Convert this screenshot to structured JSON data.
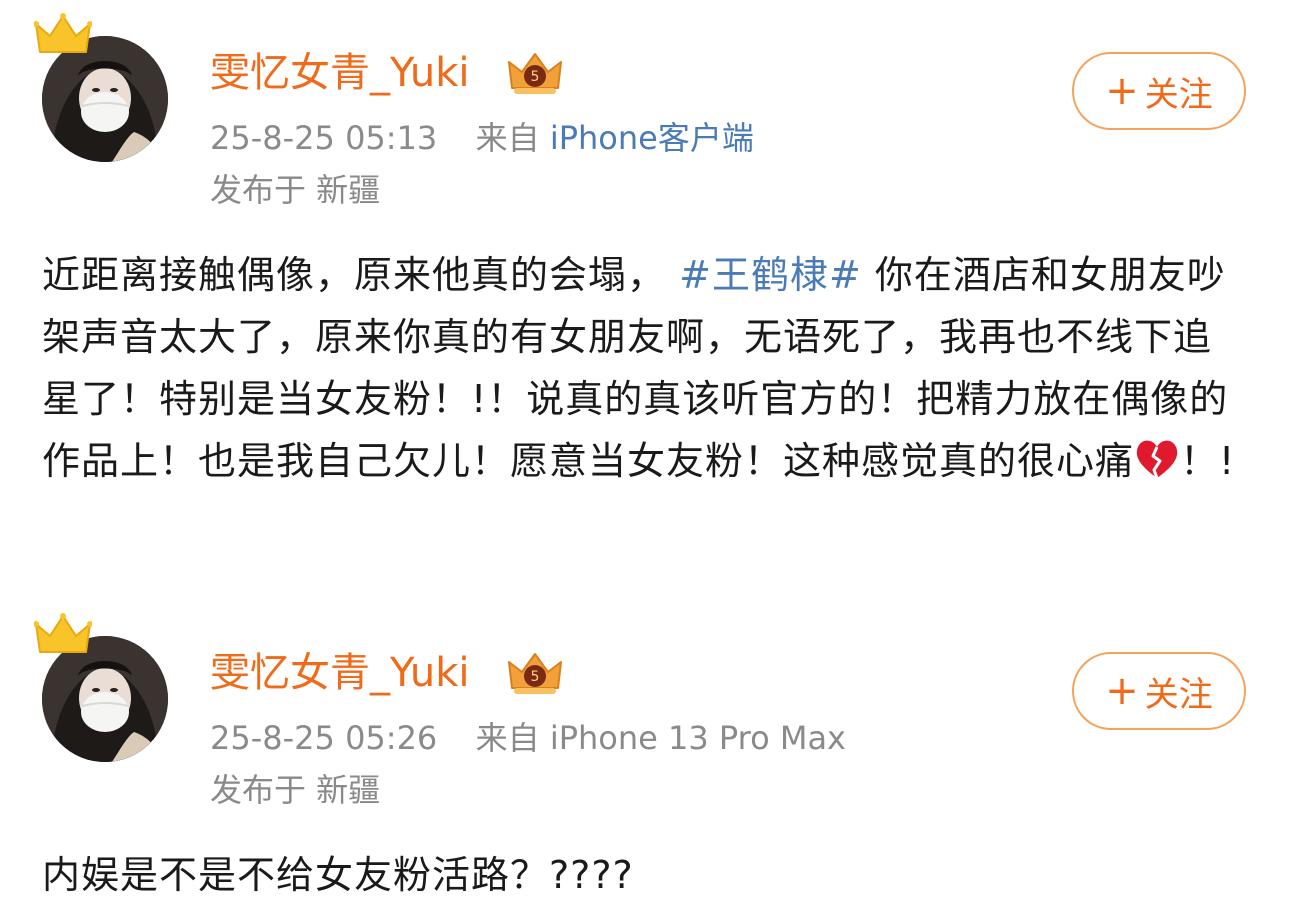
{
  "posts": [
    {
      "username": "雯忆女青_Yuki",
      "timestamp": "25-8-25 05:13",
      "source_prefix": "来自",
      "source_app": "iPhone客户端",
      "location": "发布于 新疆",
      "follow_label": "关注",
      "follow_plus": "+",
      "text_before_tag": "近距离接触偶像，原来他真的会塌，",
      "hashtag": "#王鹤棣#",
      "text_after_tag": " 你在酒店和女朋友吵架声音太大了，原来你真的有女朋友啊，无语死了，我再也不线下追星了！特别是当女友粉！!！说真的真该听官方的！把精力放在偶像的作品上！也是我自己欠儿！愿意当女友粉！这种感觉真的很心痛",
      "text_tail": "！!",
      "emoji": "broken-heart-icon"
    },
    {
      "username": "雯忆女青_Yuki",
      "timestamp": "25-8-25 05:26",
      "source_prefix": "来自",
      "source_app": "iPhone 13 Pro Max",
      "location": "发布于 新疆",
      "follow_label": "关注",
      "follow_plus": "+",
      "text": "内娱是不是不给女友粉活路？????"
    }
  ],
  "colors": {
    "username": "#f06a1a",
    "link": "#4a7bb7",
    "meta": "#8a8a8a",
    "follow_border": "#f5a25a",
    "text": "#1a1a1a"
  }
}
